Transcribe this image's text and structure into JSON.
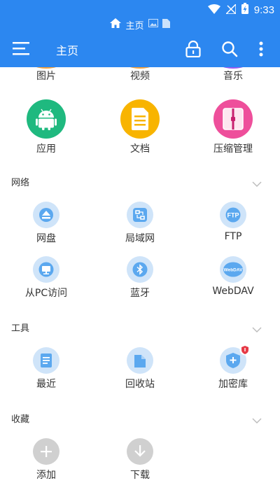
{
  "status_bar": {
    "time": "9:33"
  },
  "breadcrumb": {
    "home_label": "主页"
  },
  "toolbar": {
    "title": "主页"
  },
  "categories_top": [
    {
      "label": "图片"
    },
    {
      "label": "视频"
    },
    {
      "label": "音乐"
    }
  ],
  "categories": [
    {
      "label": "应用",
      "color": "#1fb97f"
    },
    {
      "label": "文档",
      "color": "#f8b400"
    },
    {
      "label": "压缩管理",
      "color": "#ee4f9b"
    }
  ],
  "sections": {
    "network": {
      "title": "网络",
      "items": [
        {
          "label": "网盘"
        },
        {
          "label": "局域网"
        },
        {
          "label": "FTP",
          "icon_text": "FTP"
        },
        {
          "label": "从PC访问"
        },
        {
          "label": "蓝牙"
        },
        {
          "label": "WebDAV",
          "icon_text": "WebDAV"
        }
      ]
    },
    "tools": {
      "title": "工具",
      "items": [
        {
          "label": "最近"
        },
        {
          "label": "回收站"
        },
        {
          "label": "加密库"
        }
      ]
    },
    "favorites": {
      "title": "收藏",
      "items": [
        {
          "label": "添加"
        },
        {
          "label": "下载"
        }
      ]
    }
  },
  "colors": {
    "header": "#2c87f0",
    "network_icon_bg": "#cfe4f9",
    "network_icon_fg": "#5ba8ef",
    "favorite_icon_bg": "#d0d0d0",
    "badge": "#e63946"
  }
}
